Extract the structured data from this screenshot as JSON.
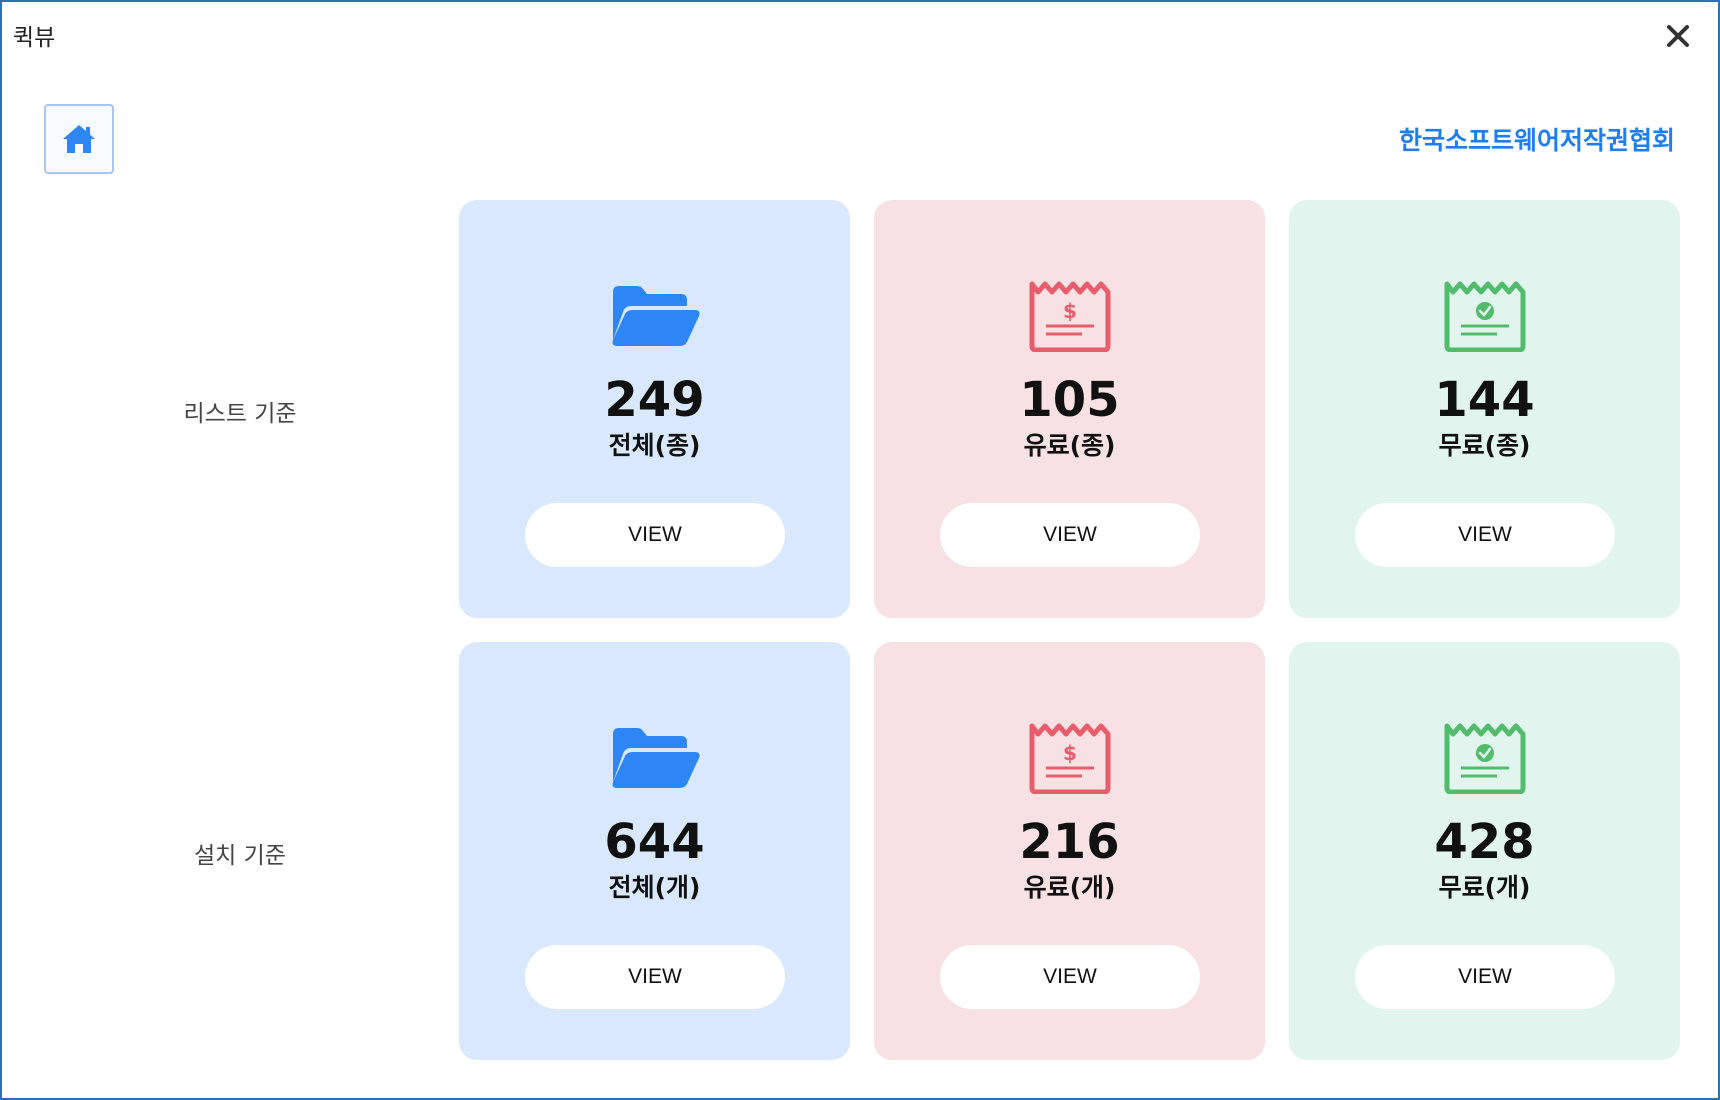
{
  "window": {
    "title": "퀵뷰",
    "close_icon": "close-icon"
  },
  "header": {
    "home_icon": "home-icon",
    "org_name": "한국소프트웨어저작권협회"
  },
  "colors": {
    "blue_card": "#d9e8fd",
    "red_card": "#f7e1e3",
    "green_card": "#e1f5ee",
    "folder_icon": "#2e86f5",
    "paid_icon": "#e85d6c",
    "free_icon": "#52bb6c",
    "accent_link": "#1e7ef0"
  },
  "rows": [
    {
      "label": "리스트 기준",
      "cards": [
        {
          "icon": "folder-icon",
          "count": "249",
          "caption": "전체(종)",
          "button": "VIEW"
        },
        {
          "icon": "paid-receipt-icon",
          "count": "105",
          "caption": "유료(종)",
          "button": "VIEW"
        },
        {
          "icon": "free-receipt-icon",
          "count": "144",
          "caption": "무료(종)",
          "button": "VIEW"
        }
      ]
    },
    {
      "label": "설치 기준",
      "cards": [
        {
          "icon": "folder-icon",
          "count": "644",
          "caption": "전체(개)",
          "button": "VIEW"
        },
        {
          "icon": "paid-receipt-icon",
          "count": "216",
          "caption": "유료(개)",
          "button": "VIEW"
        },
        {
          "icon": "free-receipt-icon",
          "count": "428",
          "caption": "무료(개)",
          "button": "VIEW"
        }
      ]
    }
  ]
}
